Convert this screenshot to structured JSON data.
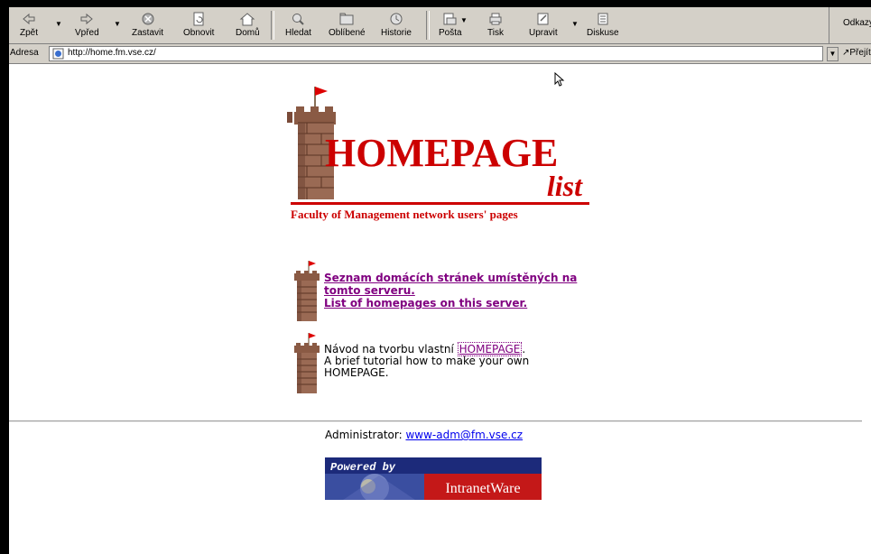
{
  "toolbar": {
    "back_label": "Zpět",
    "forward_label": "Vpřed",
    "stop_label": "Zastavit",
    "refresh_label": "Obnovit",
    "home_label": "Domů",
    "search_label": "Hledat",
    "favorites_label": "Oblíbené",
    "history_label": "Historie",
    "mail_label": "Pošta",
    "print_label": "Tisk",
    "edit_label": "Upravit",
    "discuss_label": "Diskuse",
    "links_label": "Odkazy"
  },
  "address": {
    "label": "Adresa",
    "value": "http://home.fm.vse.cz/",
    "go_label": "Přejít"
  },
  "logo": {
    "title": "HOMEPAGE",
    "subtitle": "list",
    "caption": "Faculty of Management network users' pages"
  },
  "links": {
    "list_cz": "Seznam domácích stránek umístěných na tomto serveru.",
    "list_en": "List of homepages on this server."
  },
  "tutorial": {
    "prefix": "Návod na tvorbu vlastní",
    "homepage_link": "HOMEPAGE",
    "suffix": ".",
    "english": "A brief tutorial how to make your own HOMEPAGE."
  },
  "footer": {
    "admin_label": "Administrator:",
    "admin_email": "www-adm@fm.vse.cz",
    "powered_by": "Powered by",
    "product": "IntranetWare"
  },
  "colors": {
    "toolbar_bg": "#d4d0c8",
    "logo_red": "#cc0000",
    "visited_link": "#800080",
    "link": "#0000ee"
  }
}
